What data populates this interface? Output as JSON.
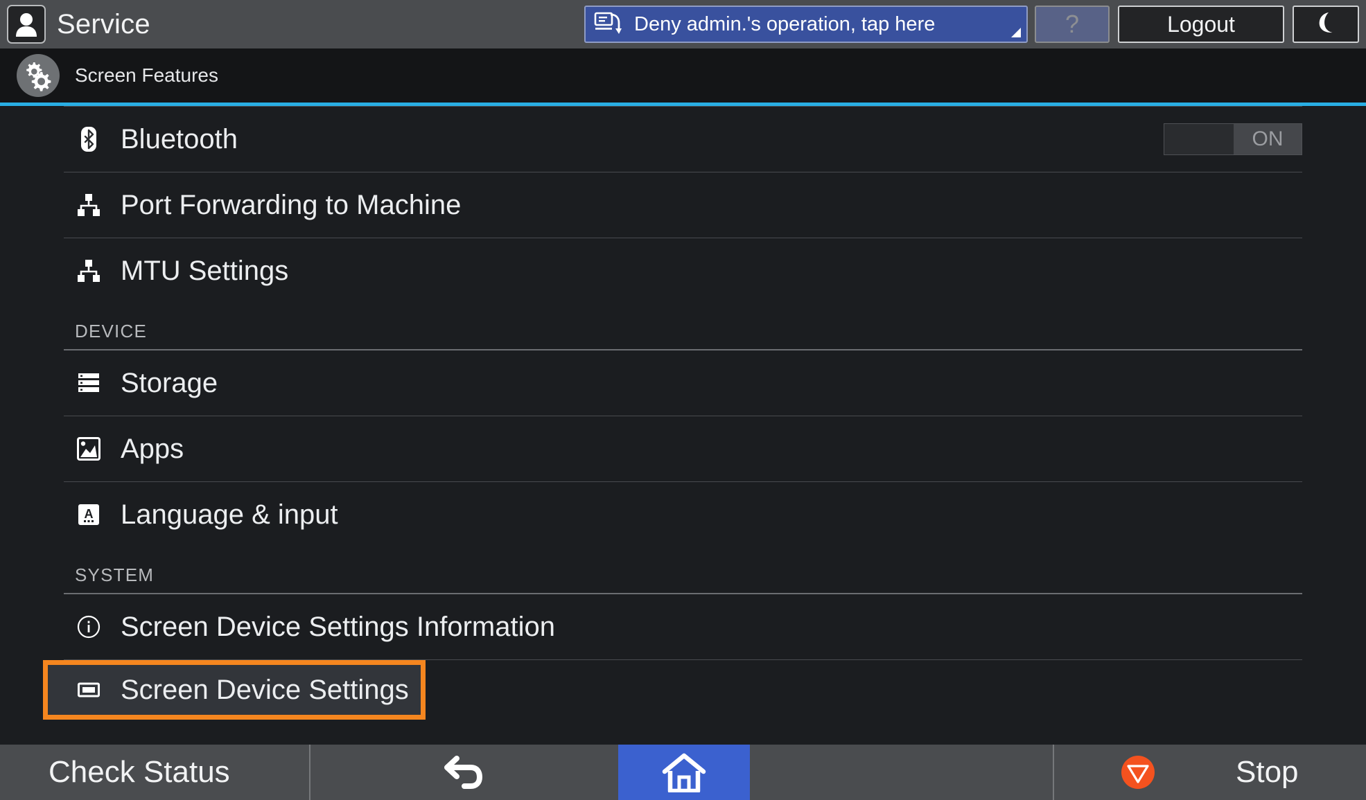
{
  "topbar": {
    "avatar_icon": "user-avatar-icon",
    "title": "Service",
    "notice": {
      "icon": "screen-transfer-icon",
      "text": "Deny admin.'s operation, tap here",
      "corner_icon": "resize-corner-icon",
      "bg_color": "#39519e"
    },
    "help_label": "?",
    "logout_label": "Logout",
    "night_mode_icon": "moon-icon"
  },
  "page_header": {
    "icon": "gears-icon",
    "title": "Screen Features",
    "accent_rule_color": "#29aee4"
  },
  "list": {
    "rows": [
      {
        "type": "item",
        "icon": "bluetooth-icon",
        "label": "Bluetooth",
        "control": "toggle",
        "toggle_state": "ON"
      },
      {
        "type": "item",
        "icon": "network-share-icon",
        "label": "Port Forwarding to Machine"
      },
      {
        "type": "item",
        "icon": "network-share-icon",
        "label": "MTU Settings"
      },
      {
        "type": "section",
        "label": "DEVICE"
      },
      {
        "type": "item",
        "icon": "storage-icon",
        "label": "Storage"
      },
      {
        "type": "item",
        "icon": "apps-image-icon",
        "label": "Apps"
      },
      {
        "type": "item",
        "icon": "language-input-icon",
        "label": "Language & input"
      },
      {
        "type": "section",
        "label": "SYSTEM"
      },
      {
        "type": "item",
        "icon": "info-circle-icon",
        "label": "Screen Device Settings Information"
      },
      {
        "type": "item",
        "icon": "monitor-icon",
        "label": "Screen Device Settings",
        "highlighted": true,
        "highlight_color": "#f5861f"
      }
    ]
  },
  "bottombar": {
    "check_status_label": "Check Status",
    "back_icon": "back-arrow-icon",
    "home_icon": "home-icon",
    "home_bg_color": "#3b61cf",
    "stop_icon": "stop-circle-icon",
    "stop_icon_color": "#f4521f",
    "stop_label": "Stop"
  }
}
